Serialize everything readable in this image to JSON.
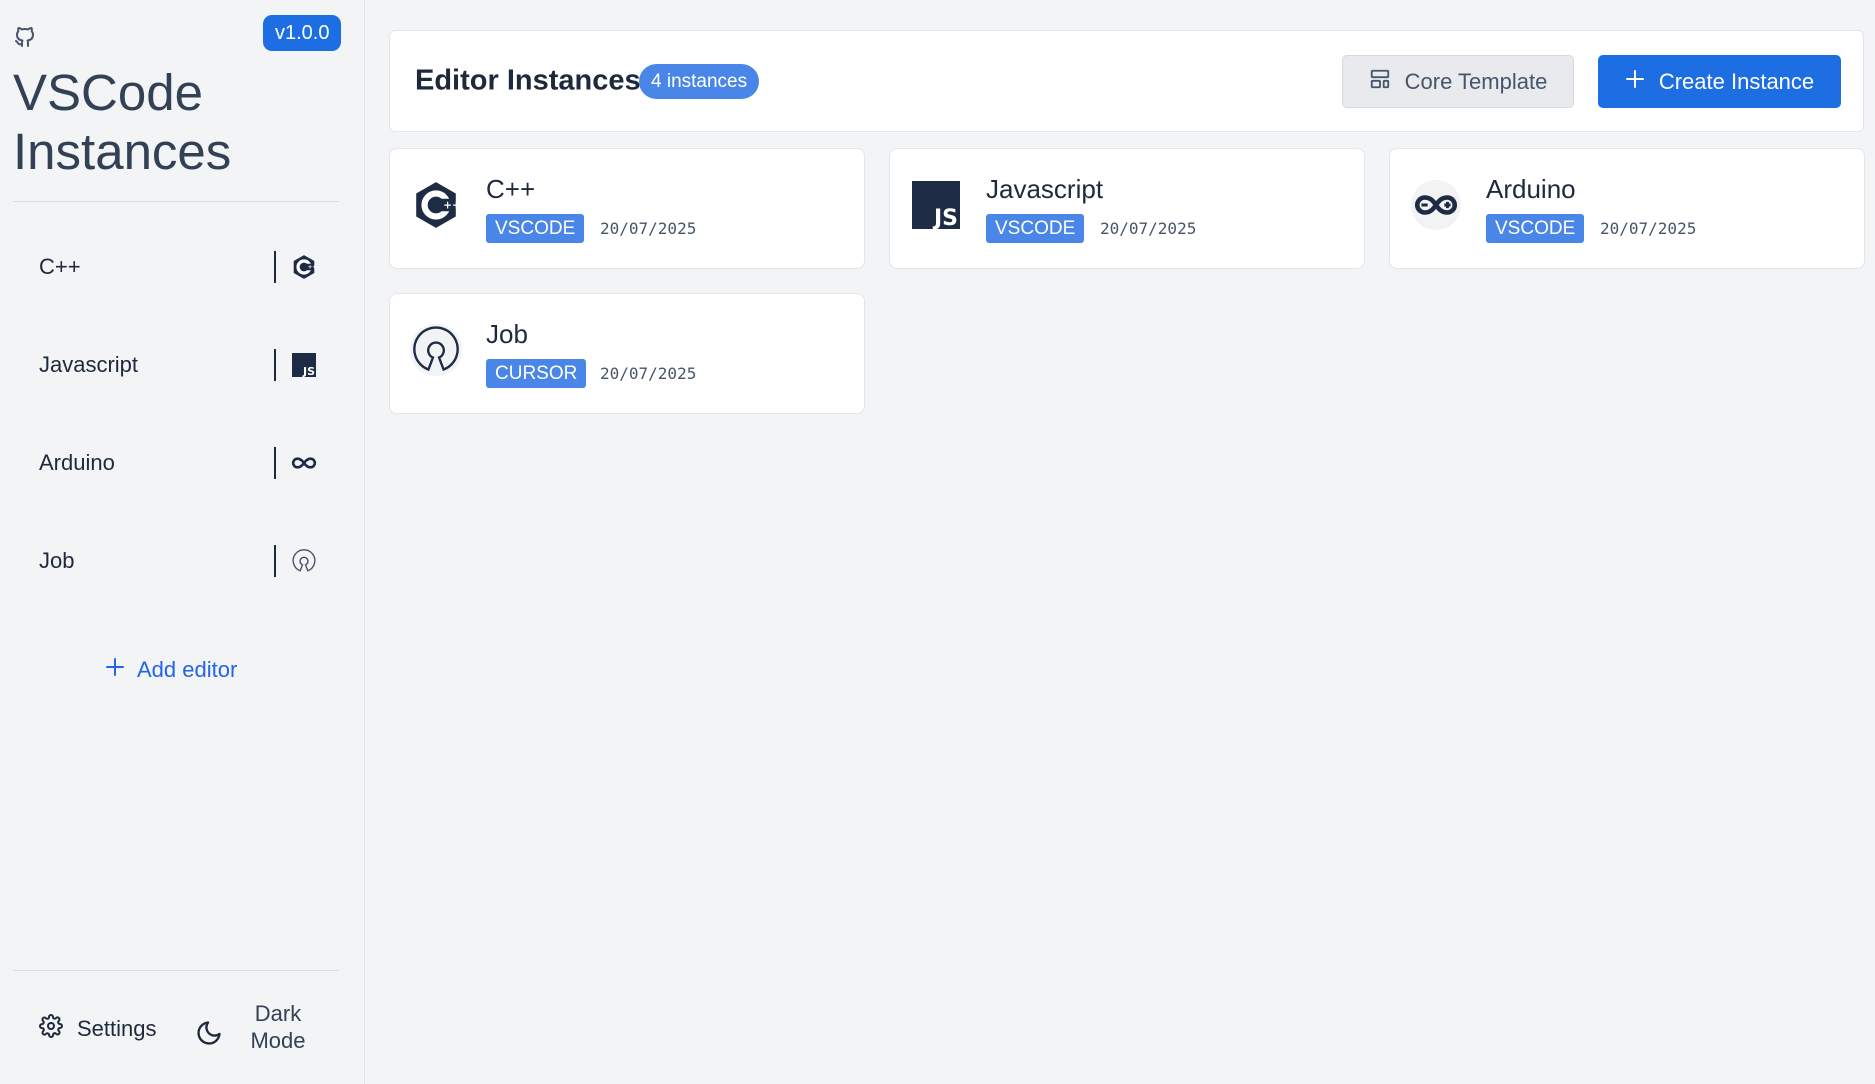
{
  "sidebar": {
    "version": "v1.0.0",
    "title": "VSCode Instances",
    "items": [
      {
        "label": "C++",
        "icon": "cpp-icon"
      },
      {
        "label": "Javascript",
        "icon": "js-icon"
      },
      {
        "label": "Arduino",
        "icon": "arduino-icon"
      },
      {
        "label": "Job",
        "icon": "opensource-icon"
      }
    ],
    "add_editor": "Add editor",
    "settings": "Settings",
    "dark_mode": "Dark Mode"
  },
  "header": {
    "title": "Editor Instances",
    "count": "4 instances",
    "core_template": "Core Template",
    "create_instance": "Create Instance"
  },
  "instances": [
    {
      "name": "C++",
      "tag": "VSCODE",
      "date": "20/07/2025",
      "icon": "cpp-icon"
    },
    {
      "name": "Javascript",
      "tag": "VSCODE",
      "date": "20/07/2025",
      "icon": "js-icon"
    },
    {
      "name": "Arduino",
      "tag": "VSCODE",
      "date": "20/07/2025",
      "icon": "arduino-icon"
    },
    {
      "name": "Job",
      "tag": "CURSOR",
      "date": "20/07/2025",
      "icon": "opensource-icon"
    }
  ],
  "colors": {
    "accent": "#1d6ee3",
    "badge": "#4a86e8",
    "background": "#f3f4f6",
    "icon_dark": "#1e2b45"
  }
}
